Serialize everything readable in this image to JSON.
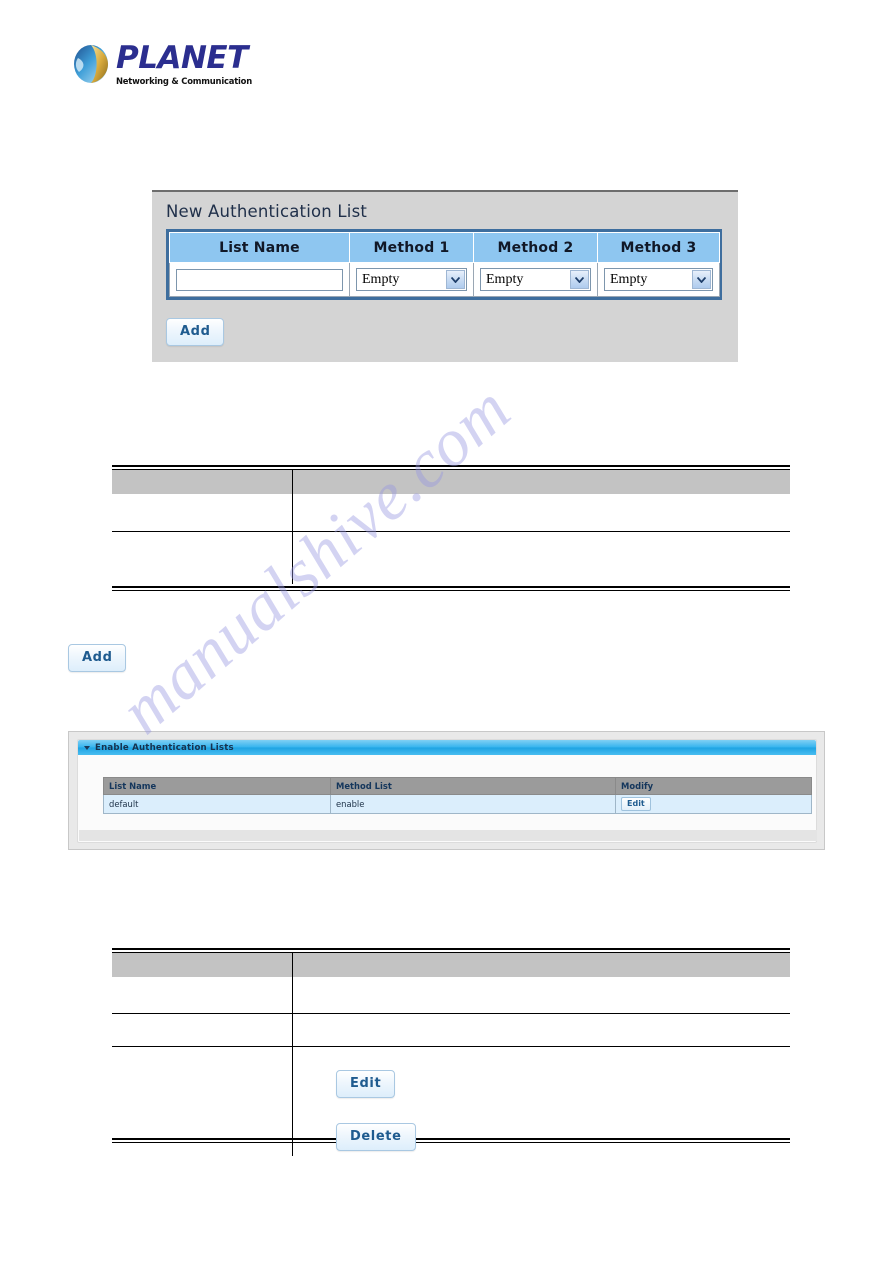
{
  "brand": {
    "name": "PLANET",
    "tagline": "Networking & Communication",
    "logo_icon": "planet-globe-icon"
  },
  "watermark": {
    "text": "manualshive.com"
  },
  "new_auth_panel": {
    "title": "New Authentication List",
    "columns": [
      "List Name",
      "Method 1",
      "Method 2",
      "Method 3"
    ],
    "row": {
      "list_name_value": "",
      "list_name_placeholder": "",
      "method1": "Empty",
      "method2": "Empty",
      "method3": "Empty"
    },
    "add_label": "Add"
  },
  "description_table_1": {
    "headers": [
      "",
      ""
    ],
    "rows": [
      [
        "",
        ""
      ],
      [
        "",
        ""
      ]
    ]
  },
  "standalone_add": {
    "label": "Add"
  },
  "enable_panel": {
    "title": "Enable Authentication Lists",
    "collapse_icon": "caret-down-icon",
    "columns": [
      "List Name",
      "Method List",
      "Modify"
    ],
    "rows": [
      {
        "list_name": "default",
        "method_list": "enable",
        "modify_label": "Edit"
      }
    ]
  },
  "description_table_2": {
    "headers": [
      "",
      ""
    ],
    "rows": [
      [
        "",
        ""
      ],
      [
        "",
        ""
      ],
      [
        "",
        ""
      ]
    ],
    "edit_label": "Edit",
    "delete_label": "Delete"
  },
  "colors": {
    "brand_blue": "#2b2e8f",
    "table_header_blue": "#8ec6f0",
    "table_border_blue": "#3e6e9e",
    "panel_gray": "#d4d4d4",
    "desc_header_gray": "#c3c3c3",
    "enable_header_cyan": "#36b4ee",
    "enable_row_blue": "#dbeefc",
    "button_text_blue": "#1f5b8f"
  }
}
